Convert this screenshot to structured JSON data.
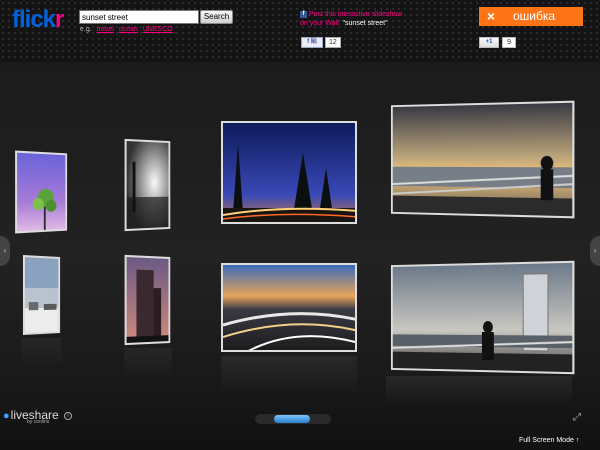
{
  "header": {
    "logo_part1": "flick",
    "logo_part2": "r",
    "search": {
      "value": "sunset street",
      "button_label": "Search"
    },
    "examples": {
      "prefix": "e.g.",
      "tags": [
        "travel",
        "ocean",
        "UNESCO"
      ]
    },
    "facebook_post": {
      "line1": "Post this interactive slideshow",
      "line2_prefix": "on your Wall: ",
      "query": "\"sunset street\""
    },
    "facebook_like": {
      "label": "f 貼",
      "count": "12"
    },
    "error_button": {
      "icon": "×",
      "label": "ошибка"
    },
    "gplus": {
      "label": "+1",
      "count": "9"
    }
  },
  "gallery": {
    "left_arrow": "‹",
    "right_arrow": "›",
    "photos": [
      "tree-purple-sky",
      "bw-street-light",
      "night-trees-light-trails",
      "waterfront-sunset-silhouette",
      "coast-snow-buildings",
      "tower-building-dusk",
      "highway-interchange-dusk",
      "waterfront-tower-silhouette"
    ]
  },
  "footer": {
    "brand": "liveshare",
    "brand_sub": "by cooliris",
    "info_icon": "i",
    "expand_icon": "⤢",
    "fullscreen_label": "Full Screen Mode ↑"
  },
  "colors": {
    "flickr_blue": "#0063dc",
    "flickr_pink": "#ff0084",
    "error_orange": "#ff7417",
    "scroll_blue": "#2b7fd0"
  }
}
